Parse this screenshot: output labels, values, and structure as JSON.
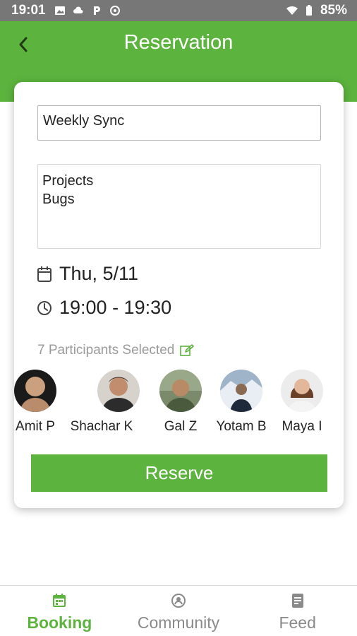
{
  "status_bar": {
    "time": "19:01",
    "battery": "85%"
  },
  "header": {
    "title": "Reservation"
  },
  "form": {
    "title_value": "Weekly Sync",
    "notes_value": "Projects\nBugs",
    "date": "Thu, 5/11",
    "time": "19:00 - 19:30",
    "participants_label": "7 Participants Selected"
  },
  "participants": [
    {
      "name": "Amit P"
    },
    {
      "name": "Shachar K"
    },
    {
      "name": "Gal Z"
    },
    {
      "name": "Yotam B"
    },
    {
      "name": "Maya I"
    }
  ],
  "actions": {
    "reserve_label": "Reserve"
  },
  "bottom_nav": {
    "items": [
      {
        "label": "Booking",
        "icon": "calendar-icon",
        "active": true
      },
      {
        "label": "Community",
        "icon": "community-icon",
        "active": false
      },
      {
        "label": "Feed",
        "icon": "feed-icon",
        "active": false
      }
    ]
  },
  "colors": {
    "accent": "#5cb33d",
    "status_bar": "#777777",
    "muted_text": "#9a9a9a"
  }
}
